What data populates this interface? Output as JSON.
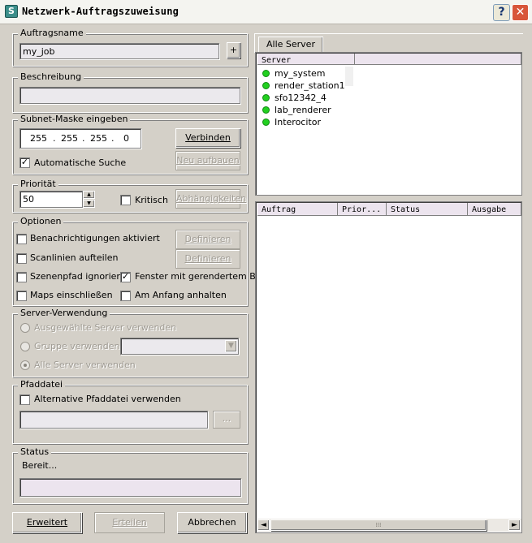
{
  "window": {
    "title": "Netzwerk-Auftragszuweisung",
    "icon": "app-icon",
    "help": "?",
    "close": "✕"
  },
  "job_name": {
    "label": "Auftragsname",
    "value": "my_job",
    "plus": "+"
  },
  "description": {
    "label": "Beschreibung",
    "value": ""
  },
  "subnet": {
    "label": "Subnet-Maske eingeben",
    "octets": [
      "255",
      "255",
      "255",
      "0"
    ],
    "connect": "Verbinden",
    "auto_search": "Automatische Suche",
    "auto_search_checked": true,
    "rebuild": "Neu aufbauen"
  },
  "priority": {
    "label": "Priorität",
    "value": "50",
    "critical": "Kritisch",
    "dependencies": "Abhängigkeiten"
  },
  "options": {
    "label": "Optionen",
    "notifications": "Benachrichtigungen aktiviert",
    "define1": "Definieren",
    "split_scanlines": "Scanlinien aufteilen",
    "define2": "Definieren",
    "ignore_scene_path": "Szenenpfad ignorieren",
    "frame_window": "Fenster mit gerendertem Bild",
    "frame_window_checked": true,
    "include_maps": "Maps einschließen",
    "hold_at_start": "Am Anfang anhalten"
  },
  "server_usage": {
    "label": "Server-Verwendung",
    "selected": "Ausgewählte Server verwenden",
    "group": "Gruppe verwenden",
    "all": "Alle Server verwenden",
    "selected_option": "all"
  },
  "path_file": {
    "label": "Pfaddatei",
    "alternative": "Alternative Pfaddatei verwenden",
    "value": "",
    "browse": "..."
  },
  "status": {
    "label": "Status",
    "text": "Bereit...",
    "value": ""
  },
  "buttons": {
    "advanced": "Erweitert",
    "submit": "Erteilen",
    "cancel": "Abbrechen"
  },
  "servers_panel": {
    "tab": "Alle Server",
    "column": "Server",
    "items": [
      {
        "name": "my_system",
        "status_color": "#22d020"
      },
      {
        "name": "render_station1",
        "status_color": "#22d020"
      },
      {
        "name": "sfo12342_4",
        "status_color": "#22d020"
      },
      {
        "name": "lab_renderer",
        "status_color": "#22d020"
      },
      {
        "name": "Interocitor",
        "status_color": "#22d020"
      }
    ]
  },
  "jobs_panel": {
    "columns": [
      "Auftrag",
      "Prior...",
      "Status",
      "Ausgabe"
    ],
    "rows": [],
    "scroll_left": "◄",
    "scroll_right": "►",
    "scroll_grip": "⁞⁞⁞"
  }
}
